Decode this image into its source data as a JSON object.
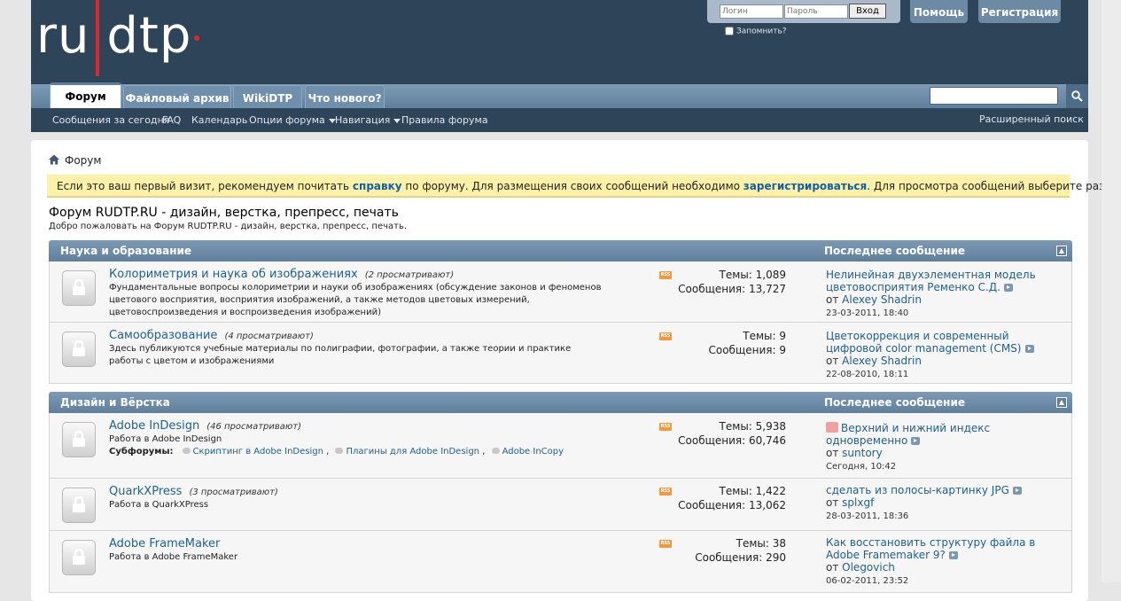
{
  "logo": {
    "text": "ru dtp"
  },
  "login": {
    "login_placeholder": "Логин",
    "password_placeholder": "Пароль",
    "submit": "Вход",
    "remember": "Запомнить?"
  },
  "header_buttons": {
    "help": "Помощь",
    "register": "Регистрация"
  },
  "tabs": [
    "Форум",
    "Файловый архив",
    "WikiDTP",
    "Что нового?"
  ],
  "subnav": {
    "today": "Сообщения за сегодня",
    "faq": "FAQ",
    "calendar": "Календарь",
    "options": "Опции форума",
    "navigation": "Навигация",
    "rules": "Правила форума",
    "advanced_search": "Расширенный поиск"
  },
  "breadcrumb": "Форум",
  "notice": {
    "part1": "Если это ваш первый визит, рекомендуем почитать ",
    "link1": "справку",
    "part2": " по форуму. Для размещения своих сообщений необходимо ",
    "link2": "зарегистрироваться",
    "part3": ". Для просмотра сообщений выберите раздел."
  },
  "forum": {
    "title": "Форум RUDTP.RU - дизайн, верстка, препресс, печать",
    "desc": "Добро пожаловать на Форум RUDTP.RU - дизайн, верстка, препресс, печать."
  },
  "categories": [
    {
      "name": "Наука и образование",
      "last_header": "Последнее сообщение",
      "forums": [
        {
          "name": "Колориметрия и наука об изображениях",
          "viewing": "(2 просматривают)",
          "desc": "Фундаментальные вопросы колориметрии и науки об изображениях (обсуждение законов и феноменов цветового восприятия, восприятия изображений, а также методов цветовых измерений, цветовоспроизведения и воспроизведения изображений)",
          "threads": "Темы: 1,089",
          "posts": "Сообщения: 13,727",
          "last_title": "Нелинейная двухэлементная модель цветовосприятия Ременко С.Д.",
          "last_by": "от ",
          "last_user": "Alexey Shadrin",
          "last_date": "23-03-2011, 18:40"
        },
        {
          "name": "Самообразование",
          "viewing": "(4 просматривают)",
          "desc": "Здесь публикуются учебные материалы по полиграфии, фотографии, а также теории и практике работы с цветом и изображениями",
          "threads": "Темы: 9",
          "posts": "Сообщения: 9",
          "last_title": "Цветокоррекция и современный цифровой color management (CMS)",
          "last_by": "от ",
          "last_user": "Alexey Shadrin",
          "last_date": "22-08-2010, 18:11"
        }
      ]
    },
    {
      "name": "Дизайн и Вёрстка",
      "last_header": "Последнее сообщение",
      "forums": [
        {
          "name": "Adobe InDesign",
          "viewing": "(46 просматривают)",
          "desc": "Работа в Adobe InDesign",
          "subforums_label": "Субфорумы:",
          "subforums": [
            "Скриптинг в Adobe InDesign",
            "Плагины для Adobe InDesign",
            "Adobe InCopy"
          ],
          "threads": "Темы: 5,938",
          "posts": "Сообщения: 60,746",
          "last_title": "Верхний и нижний индекс одновременно",
          "last_by": "от ",
          "last_user": "suntory",
          "last_date": "Сегодня, 10:42"
        },
        {
          "name": "QuarkXPress",
          "viewing": "(3 просматривают)",
          "desc": "Работа в QuarkXPress",
          "threads": "Темы: 1,422",
          "posts": "Сообщения: 13,062",
          "last_title": "сделать из полосы-картинку JPG",
          "last_by": "от ",
          "last_user": "splxgf",
          "last_date": "28-03-2011, 18:36"
        },
        {
          "name": "Adobe FrameMaker",
          "viewing": "",
          "desc": "Работа в Adobe FrameMaker",
          "threads": "Темы: 38",
          "posts": "Сообщения: 290",
          "last_title": "Как восстановить структуру файла в Adobe Framemaker 9?",
          "last_by": "от ",
          "last_user": "Olegovich",
          "last_date": "06-02-2011, 23:52"
        }
      ]
    }
  ],
  "colors": {
    "header_bg": "#2d4459",
    "accent": "#1f5f8e",
    "notice_bg": "#fff2a8",
    "logo_red": "#e0262a"
  }
}
